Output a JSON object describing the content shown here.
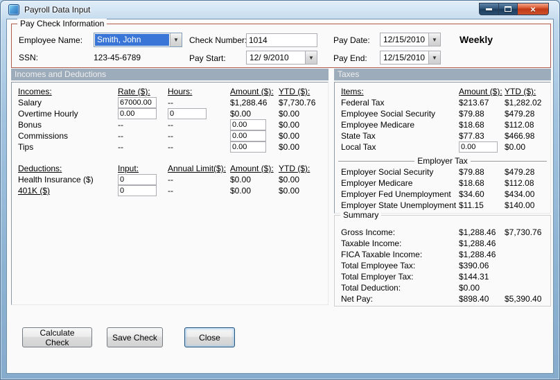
{
  "window": {
    "title": "Payroll Data Input"
  },
  "icons": {
    "dropdown_arrow": "▼",
    "close_glyph": "×"
  },
  "paycheck": {
    "group_label": "Pay Check Information",
    "employee_name_label": "Employee Name:",
    "employee_name_value": "Smith, John",
    "ssn_label": "SSN:",
    "ssn_value": "123-45-6789",
    "check_number_label": "Check Number:",
    "check_number_value": "1014",
    "pay_start_label": "Pay Start:",
    "pay_start_value": "12/ 9/2010",
    "pay_date_label": "Pay Date:",
    "pay_date_value": "12/15/2010",
    "pay_end_label": "Pay End:",
    "pay_end_value": "12/15/2010",
    "frequency": "Weekly"
  },
  "section_headers": {
    "left": "Incomes and Deductions",
    "right": "Taxes"
  },
  "incomes": {
    "headers": {
      "name": "Incomes:",
      "rate": "Rate ($):",
      "hours": "Hours:",
      "amount": "Amount ($):",
      "ytd": "YTD ($):"
    },
    "rows": [
      {
        "label": "Salary",
        "rate": "67000.00",
        "hours": "--",
        "amount": "$1,288.46",
        "ytd": "$7,730.76"
      },
      {
        "label": "Overtime Hourly",
        "rate": "0.00",
        "hours": "0",
        "amount": "$0.00",
        "ytd": "$0.00"
      },
      {
        "label": "Bonus",
        "rate": "--",
        "hours": "--",
        "amount": "0.00",
        "ytd": "$0.00"
      },
      {
        "label": "Commissions",
        "rate": "--",
        "hours": "--",
        "amount": "0.00",
        "ytd": "$0.00"
      },
      {
        "label": "Tips",
        "rate": "--",
        "hours": "--",
        "amount": "0.00",
        "ytd": "$0.00"
      }
    ]
  },
  "deductions": {
    "headers": {
      "name": "Deductions:",
      "input": "Input:",
      "limit": "Annual Limit($):",
      "amount": "Amount ($):",
      "ytd": "YTD ($):"
    },
    "rows": [
      {
        "label": "Health Insurance ($)",
        "input": "0",
        "limit": "--",
        "amount": "$0.00",
        "ytd": "$0.00"
      },
      {
        "label": "401K ($)",
        "input": "0",
        "limit": "--",
        "amount": "$0.00",
        "ytd": "$0.00"
      }
    ]
  },
  "taxes": {
    "headers": {
      "items": "Items:",
      "amount": "Amount ($):",
      "ytd": "YTD ($):"
    },
    "employee_rows": [
      {
        "label": "Federal Tax",
        "amount": "$213.67",
        "ytd": "$1,282.02"
      },
      {
        "label": "Employee Social Security",
        "amount": "$79.88",
        "ytd": "$479.28"
      },
      {
        "label": "Employee Medicare",
        "amount": "$18.68",
        "ytd": "$112.08"
      },
      {
        "label": "State Tax",
        "amount": "$77.83",
        "ytd": "$466.98"
      },
      {
        "label": "Local Tax",
        "amount": "0.00",
        "ytd": "$0.00"
      }
    ],
    "employer_divider": "Employer Tax",
    "employer_rows": [
      {
        "label": "Employer Social Security",
        "amount": "$79.88",
        "ytd": "$479.28"
      },
      {
        "label": "Employer Medicare",
        "amount": "$18.68",
        "ytd": "$112.08"
      },
      {
        "label": "Employer Fed Unemployment",
        "amount": "$34.60",
        "ytd": "$434.00"
      },
      {
        "label": "Employer State Unemployment",
        "amount": "$11.15",
        "ytd": "$140.00"
      }
    ]
  },
  "summary": {
    "group_label": "Summary",
    "rows": [
      {
        "label": "Gross Income:",
        "amount": "$1,288.46",
        "ytd": "$7,730.76"
      },
      {
        "label": "Taxable Income:",
        "amount": "$1,288.46",
        "ytd": ""
      },
      {
        "label": "FICA Taxable Income:",
        "amount": "$1,288.46",
        "ytd": ""
      },
      {
        "label": "Total Employee Tax:",
        "amount": "$390.06",
        "ytd": ""
      },
      {
        "label": "Total Employer Tax:",
        "amount": "$144.31",
        "ytd": ""
      },
      {
        "label": "Total Deduction:",
        "amount": "$0.00",
        "ytd": ""
      },
      {
        "label": "Net Pay:",
        "amount": "$898.40",
        "ytd": "$5,390.40"
      }
    ]
  },
  "buttons": {
    "calculate": "Calculate Check",
    "save": "Save Check",
    "close": "Close"
  },
  "colors": {
    "accent_group_border": "#B05B4E",
    "section_header_bg": "#9DACBB",
    "selection_blue": "#3875D6",
    "titlebar_close_red": "#C03A16"
  }
}
